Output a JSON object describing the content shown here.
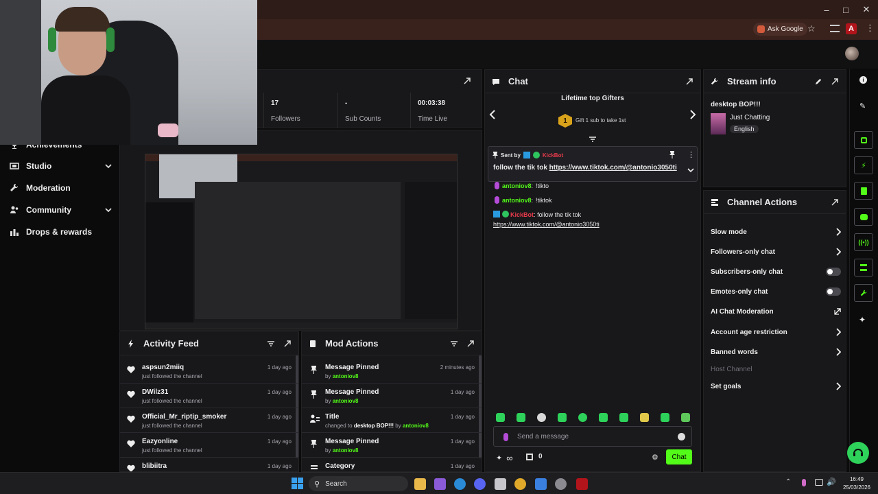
{
  "browser": {
    "ask_google": "Ask Google"
  },
  "sidebar": {
    "items": [
      {
        "label": "Achievements",
        "icon": "trophy-icon"
      },
      {
        "label": "Studio",
        "icon": "studio-icon"
      },
      {
        "label": "Moderation",
        "icon": "wrench-icon"
      },
      {
        "label": "Community",
        "icon": "community-icon"
      },
      {
        "label": "Drops & rewards",
        "icon": "drops-icon"
      }
    ]
  },
  "stats": [
    {
      "value": "17",
      "label": "Followers"
    },
    {
      "value": "-",
      "label": "Sub Counts"
    },
    {
      "value": "00:03:38",
      "label": "Time Live"
    }
  ],
  "activity_feed": {
    "title": "Activity Feed",
    "rows": [
      {
        "name": "aspsun2miiq",
        "sub": "just followed the channel",
        "date": "1 day ago"
      },
      {
        "name": "DWilz31",
        "sub": "just followed the channel",
        "date": "1 day ago"
      },
      {
        "name": "Official_Mr_riptip_smoker",
        "sub": "just followed the channel",
        "date": "1 day ago"
      },
      {
        "name": "Eazyonline",
        "sub": "just followed the channel",
        "date": "1 day ago"
      },
      {
        "name": "blibiitra",
        "sub": "",
        "date": "1 day ago"
      }
    ]
  },
  "mod_actions": {
    "title": "Mod Actions",
    "rows": [
      {
        "title": "Message Pinned",
        "by_prefix": "by",
        "user": "antoniov8",
        "date": "2 minutes ago"
      },
      {
        "title": "Message Pinned",
        "by_prefix": "by",
        "user": "antoniov8",
        "date": "1 day ago"
      },
      {
        "title": "Title",
        "by_prefix": "changed to",
        "value": "desktop BOP!!!",
        "by2": "by",
        "user": "antoniov8",
        "date": "1 day ago"
      },
      {
        "title": "Message Pinned",
        "by_prefix": "by",
        "user": "antoniov8",
        "date": "1 day ago"
      },
      {
        "title": "Category",
        "date": "1 day ago"
      }
    ]
  },
  "chat": {
    "title": "Chat",
    "gifters_title": "Lifetime top Gifters",
    "gifters_rank": "1",
    "gifters_text": "Gift 1 sub to take 1st",
    "pinned": {
      "sent_by": "Sent by",
      "user": "KickBot",
      "text": "follow the tik tok",
      "link": "https://www.tiktok.com/@antonio3050ti"
    },
    "messages": [
      {
        "user": "antoniov8",
        "text": "!tikto"
      },
      {
        "user": "antoniov8",
        "text": "!tiktok"
      },
      {
        "user": "KickBot",
        "text": "follow the tik tok",
        "link": "https://www.tiktok.com/@antonio3050ti"
      }
    ],
    "input_placeholder": "Send a message",
    "points": "0",
    "send_label": "Chat"
  },
  "stream_info": {
    "title": "Stream info",
    "stream_title": "desktop BOP!!!",
    "category": "Just Chatting",
    "language": "English"
  },
  "channel_actions": {
    "title": "Channel Actions",
    "rows": [
      {
        "label": "Slow mode",
        "control": "chevron"
      },
      {
        "label": "Followers-only chat",
        "control": "chevron"
      },
      {
        "label": "Subscribers-only chat",
        "control": "toggle"
      },
      {
        "label": "Emotes-only chat",
        "control": "toggle"
      },
      {
        "label": "AI Chat Moderation",
        "control": "external"
      },
      {
        "label": "Account age restriction",
        "control": "chevron"
      },
      {
        "label": "Banned words",
        "control": "chevron"
      },
      {
        "label": "Host Channel",
        "control": "disabled"
      },
      {
        "label": "Set goals",
        "control": "chevron"
      }
    ]
  },
  "taskbar": {
    "search_placeholder": "Search",
    "time": "16:49",
    "date": "25/03/2026"
  },
  "colors": {
    "accent": "#53fc18",
    "kickbot": "#e83a4b",
    "panel": "#18181a"
  }
}
